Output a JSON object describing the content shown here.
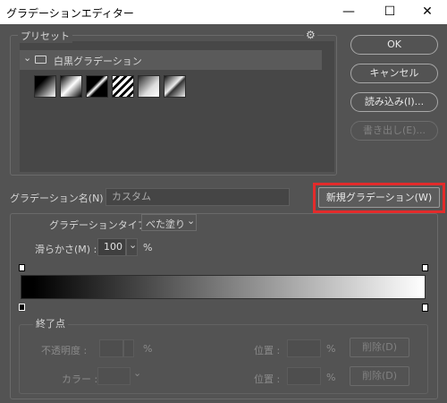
{
  "window": {
    "title": "グラデーションエディター",
    "minimize_glyph": "—",
    "maximize_glyph": "☐",
    "close_glyph": "✕"
  },
  "presets": {
    "label": "プリセット",
    "gear_glyph": "⚙",
    "folder_name": "白黒グラデーション",
    "chevron": "⌄"
  },
  "buttons": {
    "ok": "OK",
    "cancel": "キャンセル",
    "load": "読み込み(I)...",
    "save": "書き出し(E)...",
    "new_gradient": "新規グラデーション(W)"
  },
  "name_row": {
    "label": "グラデーション名(N) :",
    "value": "カスタム"
  },
  "type_row": {
    "label": "グラデーションタイプ :",
    "value": "べた塗り",
    "chevron": "⌄"
  },
  "smoothness": {
    "label": "滑らかさ(M) :",
    "value": "100",
    "chevron": "⌄",
    "unit": "%"
  },
  "stops": {
    "section_label": "終了点",
    "opacity_label": "不透明度 :",
    "opacity_unit": "%",
    "color_label": "カラー :",
    "position_label_1": "位置 :",
    "position_unit_1": "%",
    "position_label_2": "位置 :",
    "position_unit_2": "%",
    "delete_1": "削除(D)",
    "delete_2": "削除(D)"
  },
  "colors": {
    "highlight": "#e32b2b",
    "dialog_bg": "#535353"
  }
}
